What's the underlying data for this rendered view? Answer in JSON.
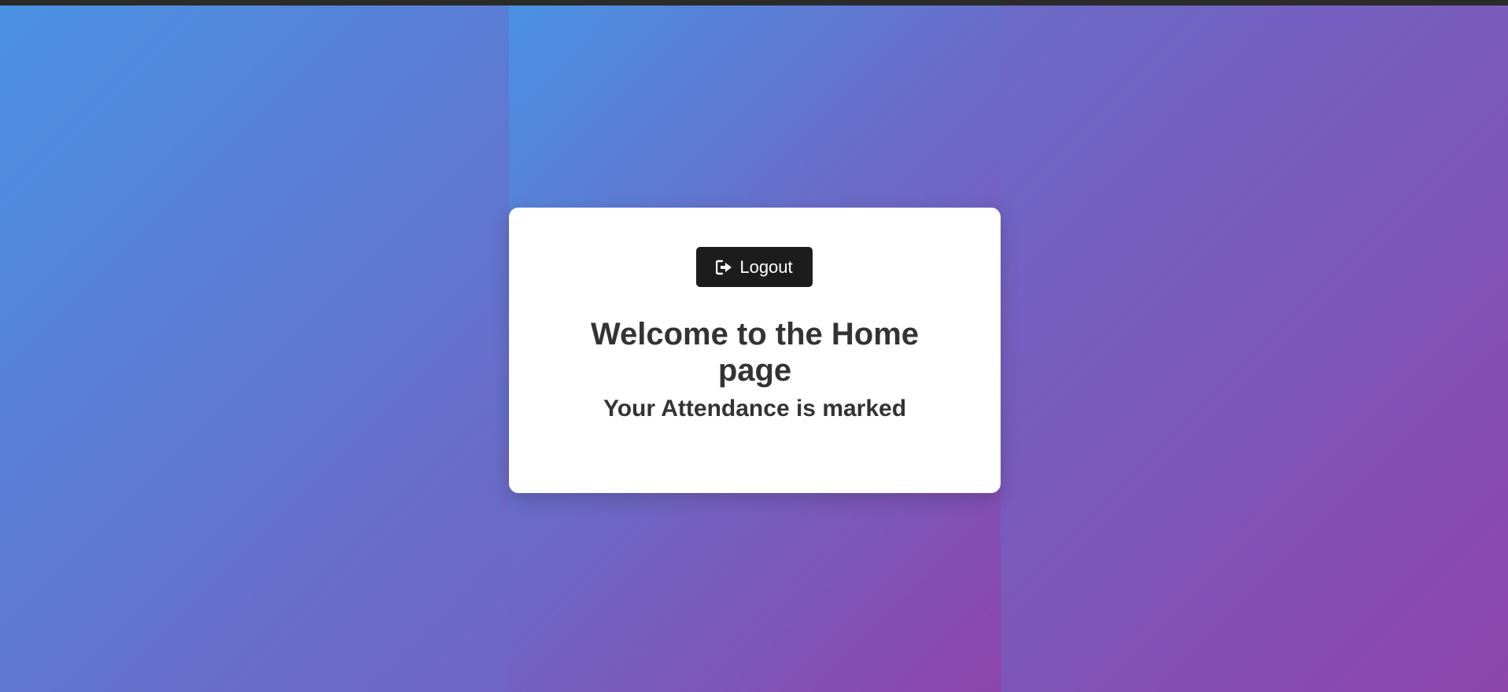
{
  "page": {
    "background_colors": [
      "#4a92e3",
      "#6a6bc8",
      "#8e44ad"
    ],
    "top_bar_color": "#2b2b2b"
  },
  "card": {
    "logout_button": {
      "label": "Logout",
      "icon": "sign-out-icon",
      "background": "#1c1c1c"
    },
    "heading_line1": "Welcome to the Home",
    "heading_line2": "page",
    "subheading": "Your Attendance is marked"
  }
}
